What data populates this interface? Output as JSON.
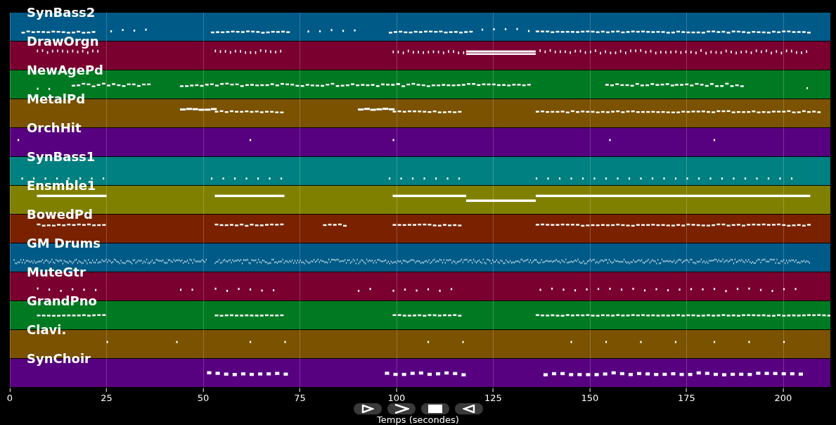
{
  "tracks": [
    {
      "name": "SynBass2",
      "color": "#005a87"
    },
    {
      "name": "DrawOrgn",
      "color": "#7a0030"
    },
    {
      "name": "NewAgePd",
      "color": "#007a22"
    },
    {
      "name": "MetalPd",
      "color": "#7a5200"
    },
    {
      "name": "OrchHit",
      "color": "#570080"
    },
    {
      "name": "SynBass1",
      "color": "#008080"
    },
    {
      "name": "Ensmble1",
      "color": "#808000"
    },
    {
      "name": "BowedPd",
      "color": "#7a2200"
    },
    {
      "name": "GM Drums",
      "color": "#005a87"
    },
    {
      "name": "MuteGtr",
      "color": "#7a0030"
    },
    {
      "name": "GrandPno",
      "color": "#007a22"
    },
    {
      "name": "Clavi.",
      "color": "#7a5200"
    },
    {
      "name": "SynChoir",
      "color": "#570080"
    }
  ],
  "axis": {
    "xlabel": "Temps (secondes)",
    "ticks": [
      "0",
      "25",
      "50",
      "75",
      "100",
      "125",
      "150",
      "175",
      "200"
    ]
  },
  "controls": [
    {
      "kind": "play"
    },
    {
      "kind": "forward"
    },
    {
      "kind": "stop"
    },
    {
      "kind": "back"
    }
  ]
}
